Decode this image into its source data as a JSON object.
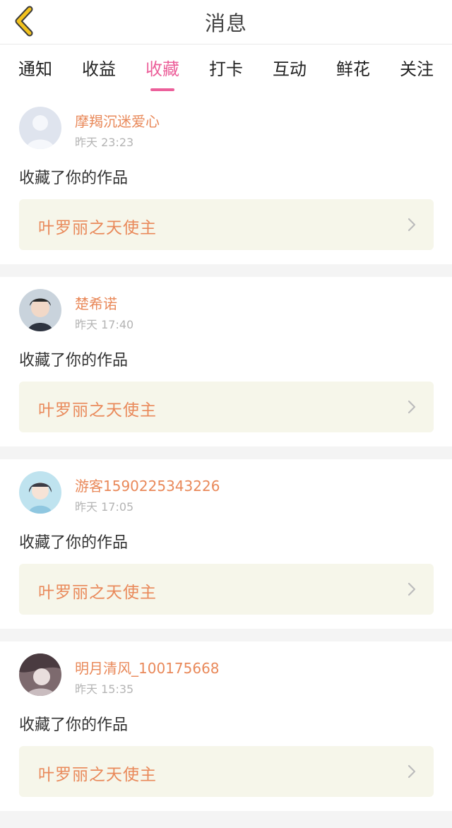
{
  "header": {
    "title": "消息"
  },
  "tabs": [
    {
      "label": "通知"
    },
    {
      "label": "收益"
    },
    {
      "label": "收藏",
      "active": true
    },
    {
      "label": "打卡"
    },
    {
      "label": "互动"
    },
    {
      "label": "鲜花"
    },
    {
      "label": "关注"
    }
  ],
  "colors": {
    "accent": "#ec5f9a",
    "username": "#e9895a",
    "back_arrow": "#f2c21e",
    "work_bg": "#f6f6ea"
  },
  "feed": [
    {
      "username": "摩羯沉迷爱心",
      "time": "昨天 23:23",
      "action": "收藏了你的作品",
      "work_title": "叶罗丽之天使主"
    },
    {
      "username": "楚希诺",
      "time": "昨天 17:40",
      "action": "收藏了你的作品",
      "work_title": "叶罗丽之天使主"
    },
    {
      "username": "游客1590225343226",
      "time": "昨天 17:05",
      "action": "收藏了你的作品",
      "work_title": "叶罗丽之天使主"
    },
    {
      "username": "明月清风_100175668",
      "time": "昨天 15:35",
      "action": "收藏了你的作品",
      "work_title": "叶罗丽之天使主"
    }
  ]
}
